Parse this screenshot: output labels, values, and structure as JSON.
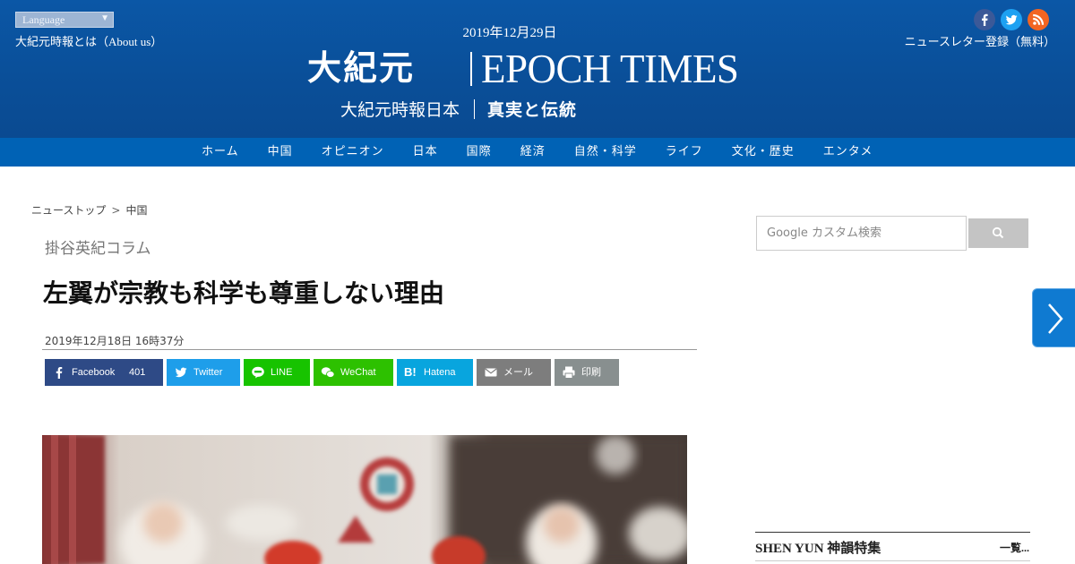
{
  "header": {
    "language_label": "Language",
    "about_link": "大紀元時報とは（About us）",
    "date": "2019年12月29日",
    "logo_kanji": "大紀元",
    "logo_latin": "EPOCH TIMES",
    "subtitle_left": "大紀元時報日本",
    "subtitle_motto": "真実と伝統",
    "newsletter_link": "ニュースレター登録（無料）",
    "social_icons": [
      "facebook-icon",
      "twitter-icon",
      "rss-icon"
    ],
    "colors": {
      "header_bg": "#0b57a6",
      "nav_bg": "#0062b5"
    }
  },
  "nav": {
    "items": [
      {
        "label": "ホーム"
      },
      {
        "label": "中国"
      },
      {
        "label": "オピニオン"
      },
      {
        "label": "日本"
      },
      {
        "label": "国際"
      },
      {
        "label": "経済"
      },
      {
        "label": "自然・科学"
      },
      {
        "label": "ライフ"
      },
      {
        "label": "文化・歴史"
      },
      {
        "label": "エンタメ"
      }
    ]
  },
  "breadcrumb": {
    "home": "ニューストップ",
    "separator": ">",
    "current": "中国"
  },
  "article": {
    "column": "掛谷英紀コラム",
    "title": "左翼が宗教も科学も尊重しない理由",
    "published": "2019年12月18日 16時37分"
  },
  "share": {
    "facebook": {
      "label": "Facebook",
      "count": "401"
    },
    "twitter": {
      "label": "Twitter"
    },
    "line": {
      "label": "LINE"
    },
    "wechat": {
      "label": "WeChat"
    },
    "hatena": {
      "label": "Hatena"
    },
    "mail": {
      "label": "メール"
    },
    "print": {
      "label": "印刷"
    }
  },
  "sidebar": {
    "search_placeholder": "Google カスタム検索",
    "shenyun_title": "SHEN YUN 神韻特集",
    "shenyun_more": "一覧..."
  }
}
